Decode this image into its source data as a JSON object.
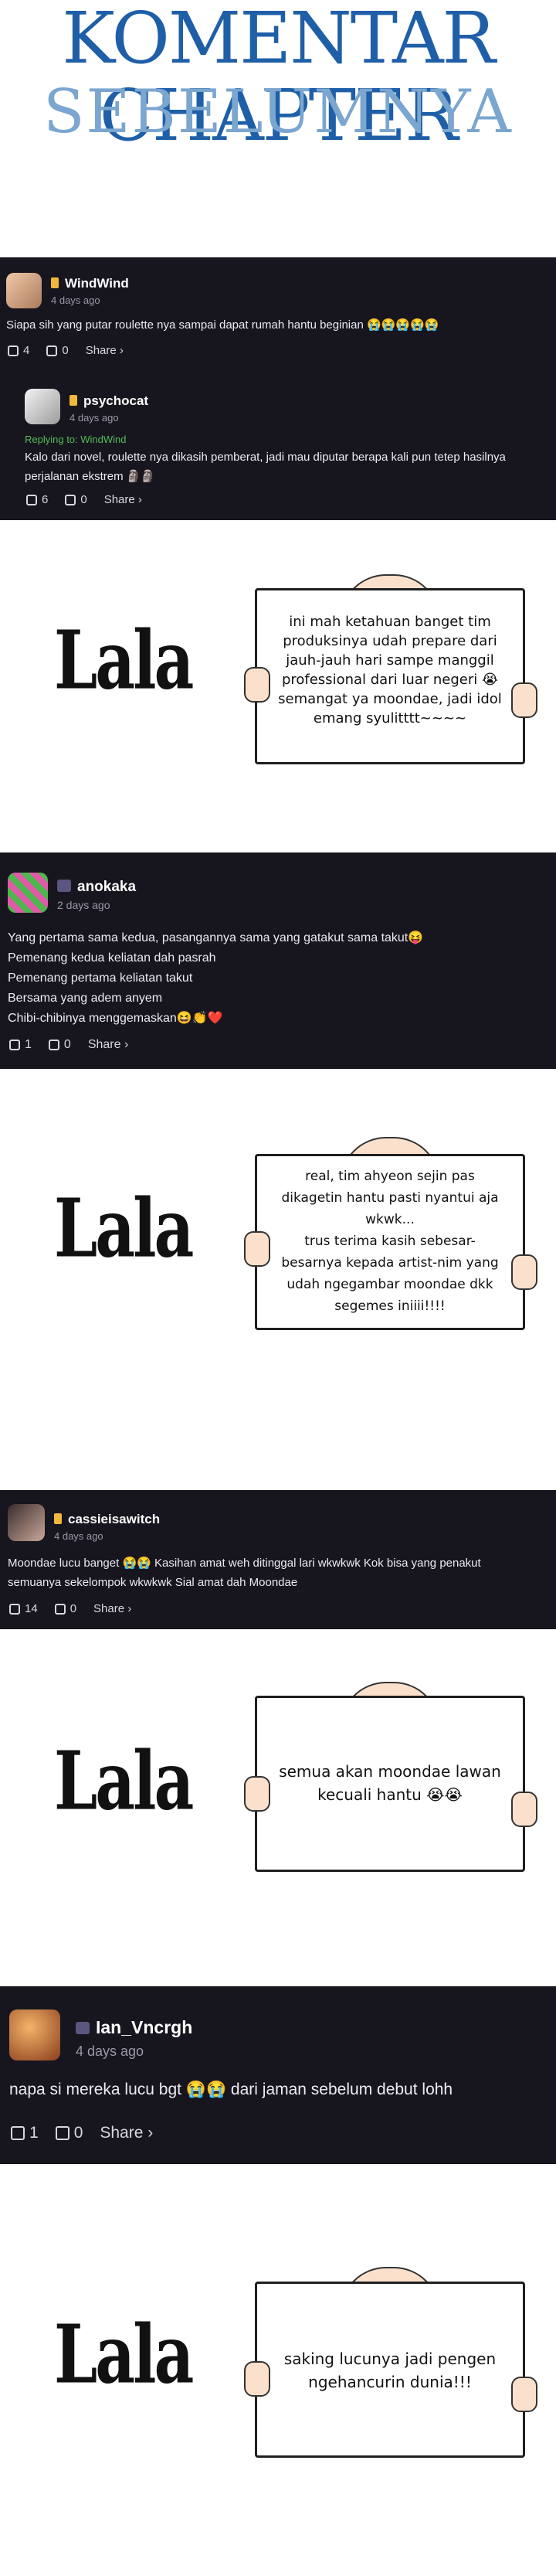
{
  "header": {
    "title_line1": "KOMENTAR CHAPTER",
    "title_line2": "SEBELUMNYA"
  },
  "comments": [
    {
      "username": "WindWind",
      "time": "4 days ago",
      "text": "Siapa sih yang putar roulette nya sampai dapat rumah hantu beginian 😭😭😭😭😭",
      "likes": "4",
      "dislikes": "0",
      "share": "Share ›",
      "reply": {
        "username": "psychocat",
        "time": "4 days ago",
        "replying_to": "Replying to: WindWind",
        "text_line1": "Kalo dari novel, roulette nya dikasih pemberat, jadi mau diputar berapa kali pun tetep hasilnya",
        "text_line2": "perjalanan ekstrem 🗿🗿",
        "likes": "6",
        "dislikes": "0",
        "share": "Share ›"
      }
    },
    {
      "username": "anokaka",
      "time": "2 days ago",
      "lines": [
        "Yang pertama sama kedua, pasangannya sama yang gatakut sama takut😝",
        "Pemenang kedua keliatan dah pasrah",
        "Pemenang pertama keliatan takut",
        "Bersama yang adem anyem",
        "Chibi-chibinya menggemaskan😆👏❤️"
      ],
      "likes": "1",
      "dislikes": "0",
      "share": "Share ›"
    },
    {
      "username": "cassieisawitch",
      "time": "4 days ago",
      "text_line1": "Moondae lucu banget 😭😭 Kasihan amat weh ditinggal lari wkwkwk Kok bisa yang penakut",
      "text_line2": "semuanya sekelompok wkwkwk Sial amat dah Moondae",
      "likes": "14",
      "dislikes": "0",
      "share": "Share ›"
    },
    {
      "username": "Ian_Vncrgh",
      "time": "4 days ago",
      "text": "napa si mereka lucu bgt 😭😭 dari jaman sebelum debut lohh",
      "likes": "1",
      "dislikes": "0",
      "share": "Share ›"
    }
  ],
  "responses": [
    {
      "name": "Lala",
      "lines": [
        "ini mah ketahuan banget tim",
        "produksinya udah prepare dari",
        "jauh-jauh hari sampe manggil",
        "professional dari luar negeri 😭",
        "semangat ya moondae, jadi idol",
        "emang syulitttt~~~~"
      ]
    },
    {
      "name": "Lala",
      "lines": [
        "real, tim ahyeon sejin pas",
        "dikagetin hantu pasti nyantui aja",
        "wkwk...",
        "trus terima kasih sebesar-",
        "besarnya kepada artist-nim yang",
        "udah ngegambar moondae dkk",
        "segemes iniiii!!!!"
      ]
    },
    {
      "name": "Lala",
      "lines": [
        "semua akan moondae lawan",
        "kecuali hantu 😭😭"
      ]
    },
    {
      "name": "Lala",
      "lines": [
        "saking lucunya jadi pengen",
        "ngehancurin dunia!!!"
      ]
    }
  ],
  "colors": {
    "dark_bg": "#17151e",
    "title_blue": "#1f5fa8",
    "title_light_blue": "#7aa6cf",
    "reply_green": "#4fbf55",
    "badge_gold": "#f0b83a"
  }
}
